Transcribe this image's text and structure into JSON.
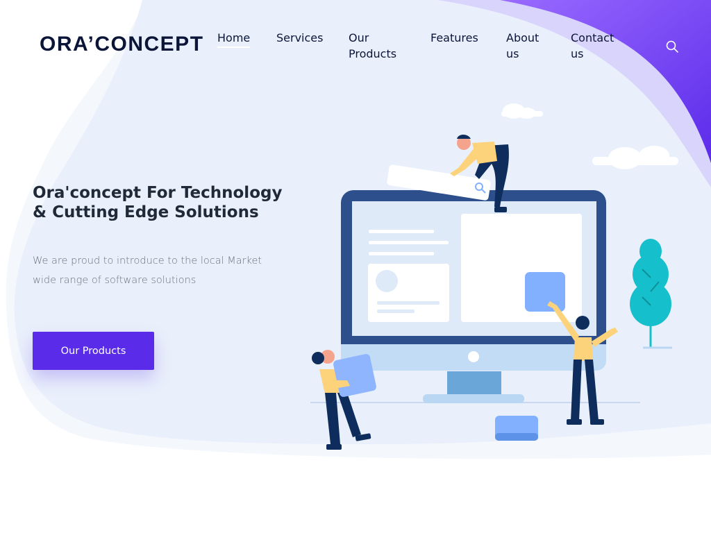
{
  "brand": {
    "logo_text": "ORA’CONCEPT"
  },
  "nav": {
    "items": [
      {
        "label": "Home",
        "active": true
      },
      {
        "label": "Services",
        "active": false
      },
      {
        "label": "Our Products",
        "active": false
      },
      {
        "label": "Features",
        "active": false
      },
      {
        "label": "About us",
        "active": false
      },
      {
        "label": "Contact us",
        "active": false
      }
    ],
    "search_icon": "search-icon"
  },
  "hero": {
    "title": "Ora'concept For Technology & Cutting Edge Solutions",
    "subtitle": "We are proud to introduce to the local Market wide range of software solutions",
    "cta_label": "Our Products"
  },
  "colors": {
    "primary": "#5b2bea",
    "background_blob": "#eaf1fb",
    "accent_gradient_start": "#8b5cf6",
    "accent_gradient_end": "#5b2bea",
    "text_dark": "#0b1538",
    "text_muted": "#6b7280",
    "monitor_frame": "#2d4f8c",
    "figure_yellow": "#fcd37a",
    "figure_navy": "#0e2d5c",
    "tree_teal": "#15c0cc"
  }
}
